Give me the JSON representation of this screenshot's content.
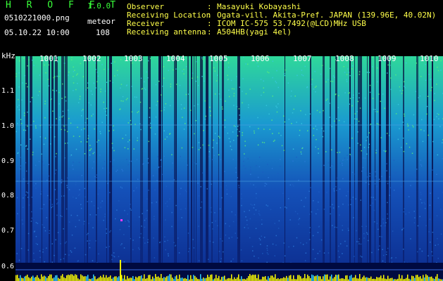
{
  "header": {
    "app_title": "H R O F F T",
    "app_version": "1.0.0",
    "file_name": "0510221000.png",
    "mode": "meteor",
    "datetime": "05.10.22 10:00",
    "count": "108"
  },
  "info": [
    {
      "key": "Observer",
      "value": "Masayuki Kobayashi"
    },
    {
      "key": "Receiving Location",
      "value": "Ogata-vill. Akita-Pref. JAPAN (139.96E, 40.02N)"
    },
    {
      "key": "Receiver",
      "value": "ICOM IC-575 53.7492(@LCD)MHz USB"
    },
    {
      "key": "Receiving antenna",
      "value": "A504HB(yagi 4el)"
    }
  ],
  "spectrogram": {
    "frequency_unit": "kHz",
    "frequency_ticks": [
      "1.1",
      "1.0",
      "0.9",
      "0.8",
      "0.7",
      "0.6"
    ],
    "time_ticks": [
      "1001",
      "1002",
      "1003",
      "1004",
      "1005",
      "1006",
      "1007",
      "1008",
      "1009",
      "1010"
    ]
  },
  "colors": {
    "background": "#000000",
    "title_green": "#39ff3a",
    "info_yellow": "#ffff4a",
    "spectrogram_low": "#0a1f80",
    "spectrogram_high": "#33e58f",
    "baseline_yellow": "#ffff00"
  }
}
